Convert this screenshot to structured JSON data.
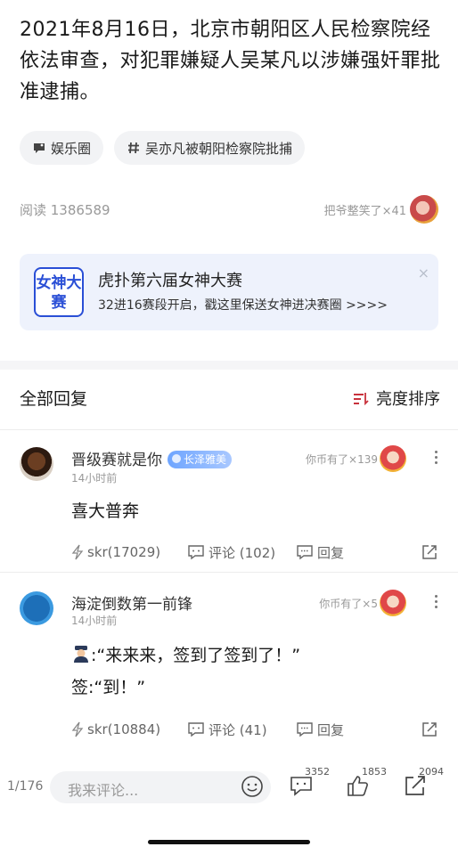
{
  "article": {
    "text": "2021年8月16日，北京市朝阳区人民检察院经依法审查，对犯罪嫌疑人吴某凡以涉嫌强奸罪批准逮捕。",
    "tags": [
      {
        "icon": "chat-bubble-icon",
        "label": "娱乐圈"
      },
      {
        "icon": "hashtag-icon",
        "label": "吴亦凡被朝阳检察院批捕"
      }
    ],
    "reads": "阅读 1386589",
    "reaction": "把爷整笑了×41"
  },
  "banner": {
    "logo_text": "女神大赛",
    "title": "虎扑第六届女神大赛",
    "subtitle": "32进16赛段开启，戳这里保送女神进决赛圈 >>>>",
    "close": "×"
  },
  "replies": {
    "title": "全部回复",
    "sort_label": "亮度排序"
  },
  "comments": [
    {
      "name": "晋级赛就是你",
      "badge": "长泽雅美",
      "time": "14小时前",
      "reaction": "你币有了×139",
      "body": [
        "喜大普奔"
      ],
      "skr": "skr(17029)",
      "comment": "评论 (102)",
      "reply": "回复"
    },
    {
      "name": "海淀倒数第一前锋",
      "time": "14小时前",
      "reaction": "你币有了×5",
      "body_line1": ":“来来来，签到了签到了！”",
      "body_line2": "签:“到！”",
      "skr": "skr(10884)",
      "comment": "评论 (41)",
      "reply": "回复"
    }
  ],
  "bottom": {
    "page": "1/176",
    "placeholder": "我来评论...",
    "comments_count": "3352",
    "likes_count": "1853",
    "shares_count": "2094"
  },
  "colors": {
    "accent": "#c8323c",
    "banner_bg": "#eef2fc",
    "badge": "#6ea5ff"
  }
}
